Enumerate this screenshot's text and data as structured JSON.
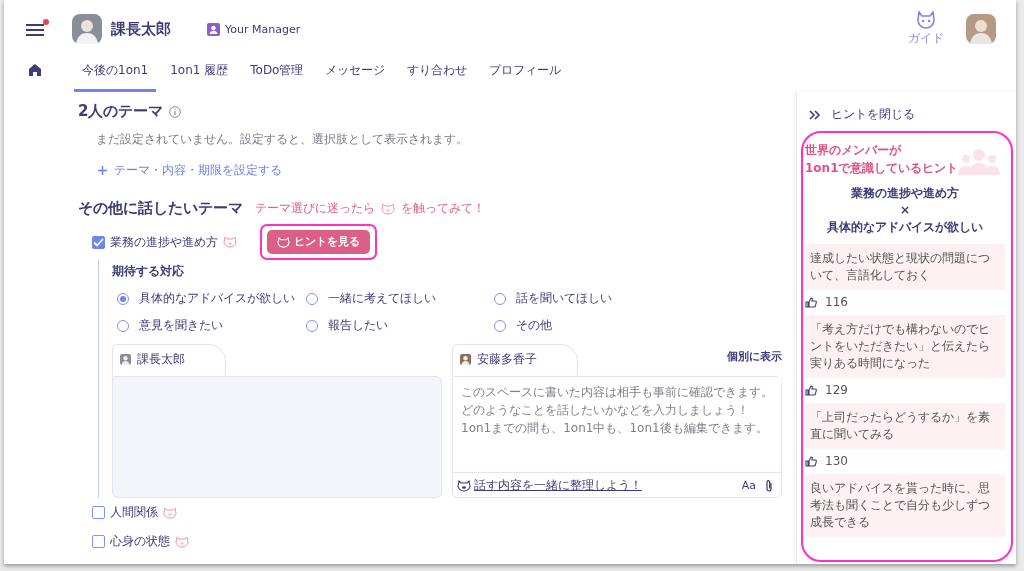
{
  "menu_notification": true,
  "header": {
    "name": "課長太郎",
    "role_badge": "Your Manager",
    "guide_label": "ガイド"
  },
  "tabs": [
    {
      "label": "今後の1on1",
      "selected": true
    },
    {
      "label": "1on1 履歴",
      "selected": false
    },
    {
      "label": "ToDo管理",
      "selected": false
    },
    {
      "label": "メッセージ",
      "selected": false
    },
    {
      "label": "すり合わせ",
      "selected": false
    },
    {
      "label": "プロフィール",
      "selected": false
    }
  ],
  "shared_themes": {
    "title": "2人のテーマ",
    "empty_message": "まだ設定されていません。設定すると、選択肢として表示されます。",
    "add_link": "テーマ・内容・期限を設定する"
  },
  "other_themes": {
    "title": "その他に話したいテーマ",
    "tip_before": "テーマ選びに迷ったら",
    "tip_after": "を触ってみて！",
    "items": [
      {
        "label": "業務の進捗や進め方",
        "checked": true,
        "hint_button": "ヒントを見る",
        "highlighted": true,
        "expected": {
          "title": "期待する対応",
          "options": [
            {
              "label": "具体的なアドバイスが欲しい",
              "selected": true
            },
            {
              "label": "一緒に考えてほしい",
              "selected": false
            },
            {
              "label": "話を聞いてほしい",
              "selected": false
            },
            {
              "label": "意見を聞きたい",
              "selected": false
            },
            {
              "label": "報告したい",
              "selected": false
            },
            {
              "label": "その他",
              "selected": false
            }
          ]
        },
        "memos": [
          {
            "kind": "readonly",
            "author": "課長太郎"
          },
          {
            "kind": "editable",
            "author": "安藤多香子",
            "toggle": "個別に表示",
            "placeholder": "このスペースに書いた内容は相手も事前に確認できます。どのようなことを話したいかなどを入力しましょう！1on1までの間も、1on1中も、1on1後も編集できます。",
            "assist_link": "話す内容を一緒に整理しよう！",
            "format_label": "Aa"
          }
        ]
      },
      {
        "label": "人間関係",
        "checked": false
      },
      {
        "label": "心身の状態",
        "checked": false
      }
    ]
  },
  "hint_panel": {
    "close_label": "ヒントを閉じる",
    "highlighted": true,
    "title_lines": [
      "世界のメンバーが",
      "1on1で意識しているヒント"
    ],
    "topic": "業務の進捗や進め方",
    "times": "×",
    "answer": "具体的なアドバイスが欲しい",
    "hints": [
      {
        "text": "達成したい状態と現状の問題について、言語化しておく",
        "likes": "116"
      },
      {
        "text": "「考え方だけでも構わないのでヒントをいただきたい」と伝えたら実りある時間になった",
        "likes": "129"
      },
      {
        "text": "「上司だったらどうするか」を素直に聞いてみる",
        "likes": "130"
      },
      {
        "text": "良いアドバイスを貰った時に、思考法も聞くことで自分も少しずつ成長できる"
      }
    ]
  }
}
